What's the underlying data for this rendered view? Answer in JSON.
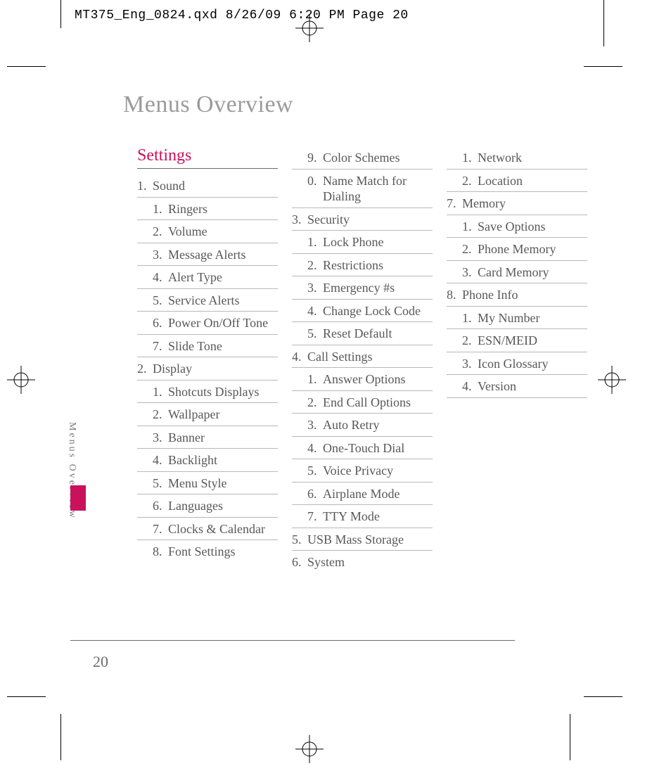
{
  "qxd_header": "MT375_Eng_0824.qxd  8/26/09  6:20 PM  Page 20",
  "page_title": "Menus Overview",
  "side_text": "Menus Overview",
  "page_number": "20",
  "col1": {
    "heading": "Settings",
    "items": [
      {
        "type": "lvl1",
        "num": "1.",
        "txt": "Sound"
      },
      {
        "type": "lvl2",
        "num": "1.",
        "txt": "Ringers"
      },
      {
        "type": "lvl2",
        "num": "2.",
        "txt": "Volume"
      },
      {
        "type": "lvl2",
        "num": "3.",
        "txt": "Message Alerts"
      },
      {
        "type": "lvl2",
        "num": "4.",
        "txt": "Alert Type"
      },
      {
        "type": "lvl2",
        "num": "5.",
        "txt": "Service Alerts"
      },
      {
        "type": "lvl2",
        "num": "6.",
        "txt": "Power On/Off Tone"
      },
      {
        "type": "lvl2",
        "num": "7.",
        "txt": "Slide Tone"
      },
      {
        "type": "lvl1",
        "num": "2.",
        "txt": "Display"
      },
      {
        "type": "lvl2",
        "num": "1.",
        "txt": " Shotcuts Displays"
      },
      {
        "type": "lvl2",
        "num": "2.",
        "txt": "Wallpaper"
      },
      {
        "type": "lvl2",
        "num": "3.",
        "txt": "Banner"
      },
      {
        "type": "lvl2",
        "num": "4.",
        "txt": "Backlight"
      },
      {
        "type": "lvl2",
        "num": "5.",
        "txt": "Menu Style"
      },
      {
        "type": "lvl2",
        "num": "6.",
        "txt": "Languages"
      },
      {
        "type": "lvl2",
        "num": "7.",
        "txt": "Clocks & Calendar"
      },
      {
        "type": "lvl2",
        "num": "8.",
        "txt": "Font Settings",
        "noborder": true
      }
    ]
  },
  "col2": {
    "items": [
      {
        "type": "lvl2",
        "num": "9.",
        "txt": "Color Schemes"
      },
      {
        "type": "lvl2",
        "num": "0.",
        "txt": "Name Match for Dialing"
      },
      {
        "type": "lvl1",
        "num": "3.",
        "txt": "Security"
      },
      {
        "type": "lvl2",
        "num": "1.",
        "txt": "Lock Phone"
      },
      {
        "type": "lvl2",
        "num": "2.",
        "txt": "Restrictions"
      },
      {
        "type": "lvl2",
        "num": "3.",
        "txt": "Emergency #s"
      },
      {
        "type": "lvl2",
        "num": "4.",
        "txt": "Change Lock Code"
      },
      {
        "type": "lvl2",
        "num": "5.",
        "txt": "Reset Default"
      },
      {
        "type": "lvl1",
        "num": "4.",
        "txt": "Call Settings"
      },
      {
        "type": "lvl2",
        "num": "1.",
        "txt": "Answer Options"
      },
      {
        "type": "lvl2",
        "num": "2.",
        "txt": "End Call Options"
      },
      {
        "type": "lvl2",
        "num": "3.",
        "txt": "Auto Retry"
      },
      {
        "type": "lvl2",
        "num": "4.",
        "txt": "One-Touch Dial"
      },
      {
        "type": "lvl2",
        "num": "5.",
        "txt": "Voice Privacy"
      },
      {
        "type": "lvl2",
        "num": "6.",
        "txt": "Airplane Mode"
      },
      {
        "type": "lvl2",
        "num": "7.",
        "txt": "TTY Mode"
      },
      {
        "type": "lvl1",
        "num": "5.",
        "txt": "USB Mass Storage"
      },
      {
        "type": "lvl1",
        "num": "6.",
        "txt": "System",
        "noborder": true
      }
    ]
  },
  "col3": {
    "items": [
      {
        "type": "lvl2",
        "num": "1.",
        "txt": "Network"
      },
      {
        "type": "lvl2",
        "num": "2.",
        "txt": "Location"
      },
      {
        "type": "lvl1",
        "num": "7.",
        "txt": "Memory"
      },
      {
        "type": "lvl2",
        "num": "1.",
        "txt": "Save Options"
      },
      {
        "type": "lvl2",
        "num": "2.",
        "txt": "Phone Memory"
      },
      {
        "type": "lvl2",
        "num": "3.",
        "txt": "Card Memory"
      },
      {
        "type": "lvl1",
        "num": "8.",
        "txt": "Phone Info"
      },
      {
        "type": "lvl2",
        "num": "1.",
        "txt": "My Number"
      },
      {
        "type": "lvl2",
        "num": "2.",
        "txt": "ESN/MEID"
      },
      {
        "type": "lvl2",
        "num": "3.",
        "txt": "Icon Glossary"
      },
      {
        "type": "lvl2",
        "num": "4.",
        "txt": "Version"
      }
    ]
  }
}
